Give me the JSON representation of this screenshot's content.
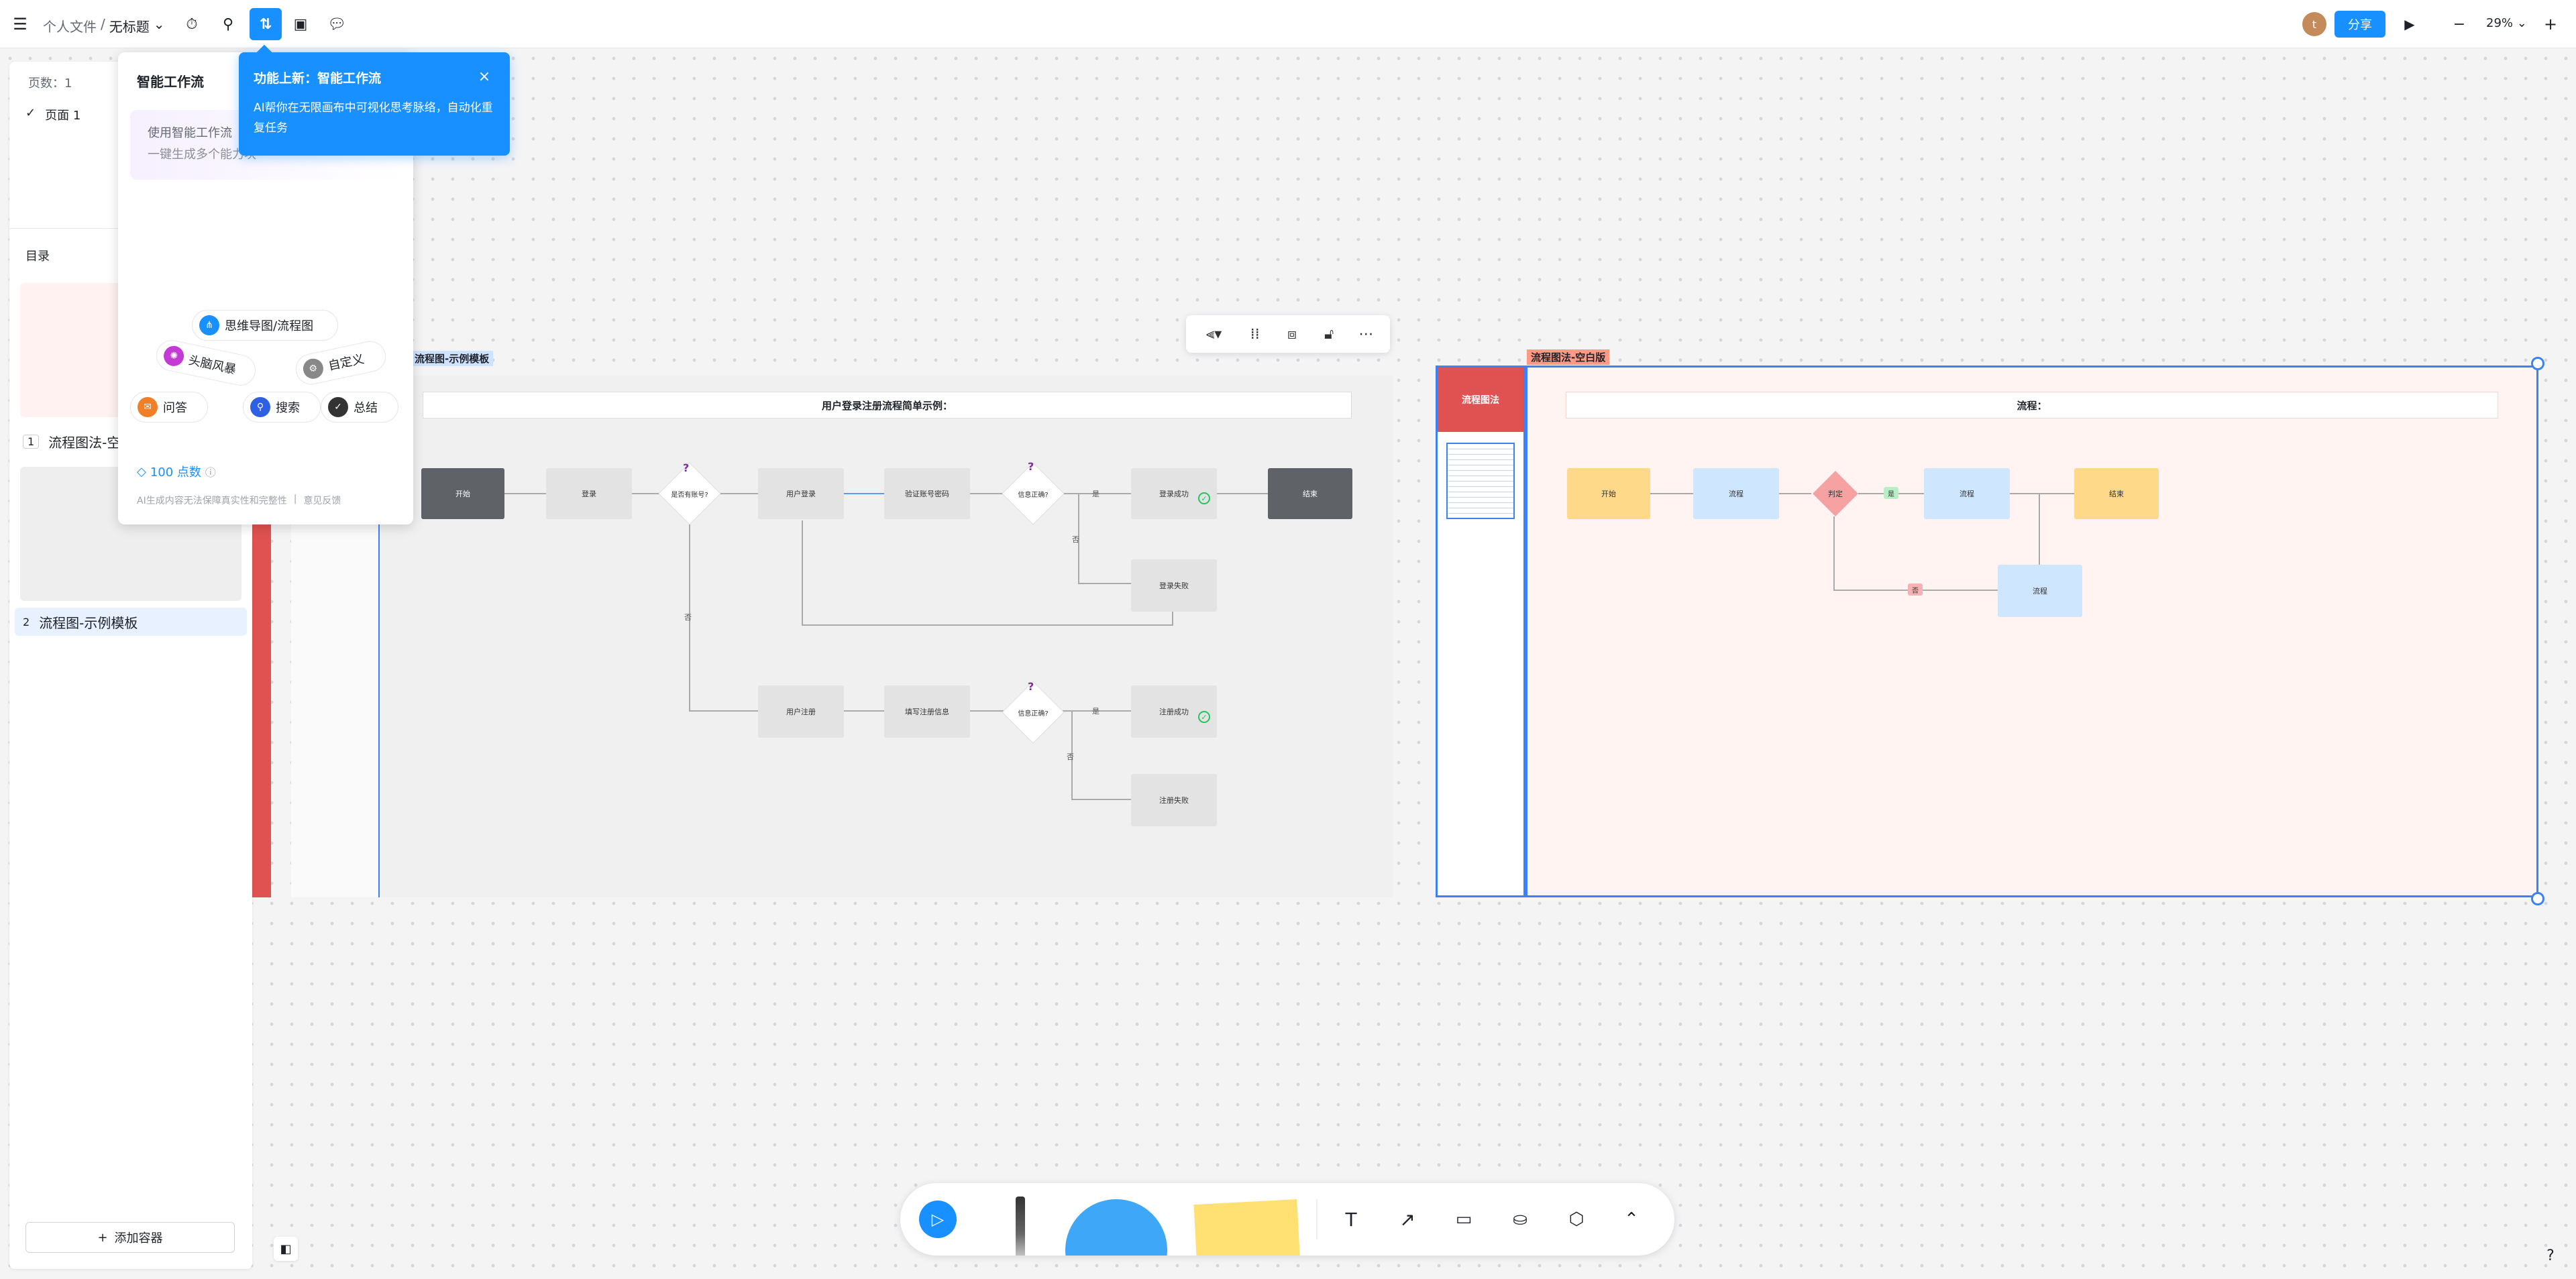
{
  "topbar": {
    "breadcrumb_root": "个人文件",
    "breadcrumb_sep": "/",
    "breadcrumb_doc": "无标题",
    "avatar_letter": "t",
    "share_label": "分享",
    "zoom": "29%"
  },
  "sidebar": {
    "page_count": "页数：1",
    "page1": "页面 1",
    "toc_title": "目录",
    "items": [
      {
        "num": "1",
        "label": "流程图法-空白版"
      },
      {
        "num": "2",
        "label": "流程图-示例模板"
      }
    ],
    "add_container": "添加容器"
  },
  "ai_panel": {
    "title": "智能工作流",
    "card_line1": "使用智能工作流",
    "card_line2": "一键生成多个能力块",
    "chips": {
      "mindmap": "思维导图/流程图",
      "brainstorm": "头脑风暴",
      "custom": "自定义",
      "qa": "问答",
      "search": "搜索",
      "summary": "总结"
    },
    "points": "100 点数",
    "disclaimer": "AI生成内容无法保障真实性和完整性",
    "feedback": "意见反馈"
  },
  "tooltip": {
    "title": "功能上新：智能工作流",
    "body": "AI帮你在无限画布中可视化思考脉络，自动化重复任务"
  },
  "canvas": {
    "frame1_label": "流程图-示例模板",
    "frame2_label": "流程图法-空白版",
    "middle_title": "流程图法",
    "flow1_title": "用户登录注册流程简单示例：",
    "flow2_title": "流程：",
    "flow1": {
      "start": "开始",
      "login": "登录",
      "has_account": "是否有账号?",
      "user_login": "用户登录",
      "verify": "验证账号密码",
      "info_ok1": "信息正确?",
      "yes1": "是",
      "no1": "否",
      "login_success": "登录成功",
      "end": "结束",
      "login_fail": "登录失败",
      "no_account": "否",
      "register": "用户注册",
      "fill_info": "填写注册信息",
      "info_ok2": "信息正确?",
      "yes2": "是",
      "no2": "否",
      "reg_success": "注册成功",
      "reg_fail": "注册失败",
      "q": "?"
    },
    "flow2": {
      "start": "开始",
      "step1": "流程",
      "decision": "判定",
      "yes": "是",
      "step2": "流程",
      "end": "结束",
      "no": "否",
      "step3": "流程"
    }
  },
  "colors": {
    "accent": "#1890ff",
    "frame_red": "#e05252",
    "pink_bg": "#fff4f2",
    "gray_bg": "#f0f0f0"
  }
}
